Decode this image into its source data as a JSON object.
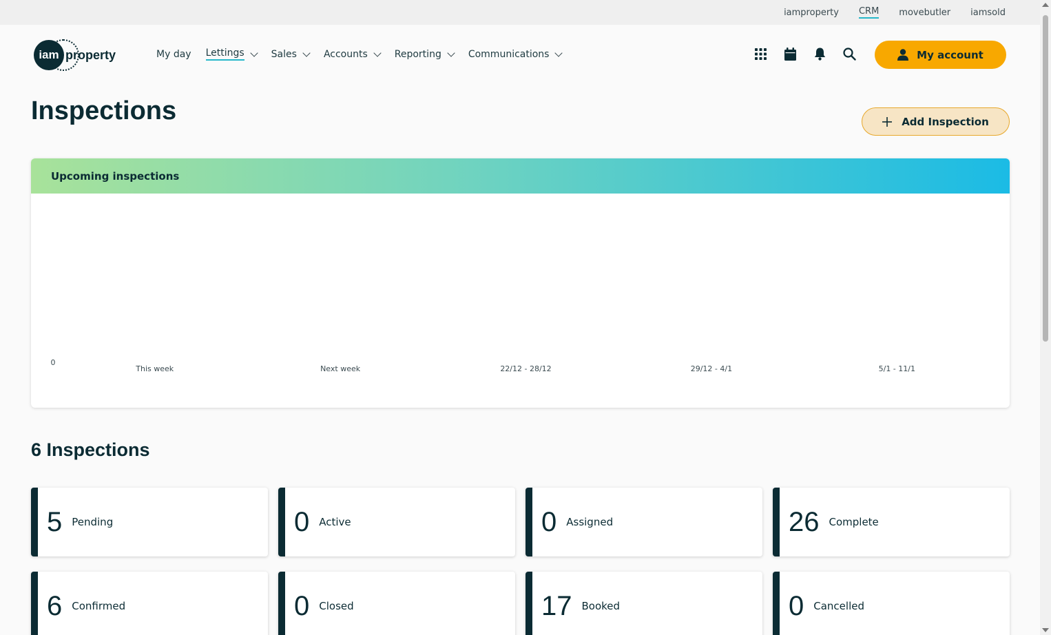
{
  "utility_nav": {
    "links": [
      "iamproperty",
      "CRM",
      "movebutler",
      "iamsold"
    ],
    "active": "CRM"
  },
  "brand": {
    "logo_mark": "iam",
    "logo_text": "property"
  },
  "main_nav": {
    "items": [
      {
        "label": "My day",
        "dropdown": false
      },
      {
        "label": "Lettings",
        "dropdown": true,
        "active": true
      },
      {
        "label": "Sales",
        "dropdown": true
      },
      {
        "label": "Accounts",
        "dropdown": true
      },
      {
        "label": "Reporting",
        "dropdown": true
      },
      {
        "label": "Communications",
        "dropdown": true
      }
    ],
    "icons": [
      "apps-grid-icon",
      "calendar-icon",
      "bell-icon",
      "search-icon"
    ],
    "account_label": "My account"
  },
  "page": {
    "title": "Inspections",
    "add_label": "Add Inspection",
    "accent_color": "#f8a800"
  },
  "chart": {
    "header": "Upcoming inspections"
  },
  "chart_data": {
    "type": "bar",
    "title": "Upcoming inspections",
    "categories": [
      "This week",
      "Next week",
      "22/12 - 28/12",
      "29/12 - 4/1",
      "5/1 - 11/1"
    ],
    "values": [
      0,
      0,
      0,
      0,
      0
    ],
    "y_ticks": [
      "0"
    ],
    "ylim": [
      0,
      1
    ],
    "grid": false
  },
  "summary": {
    "title": "6 Inspections",
    "stats": [
      {
        "value": "5",
        "label": "Pending"
      },
      {
        "value": "0",
        "label": "Active"
      },
      {
        "value": "0",
        "label": "Assigned"
      },
      {
        "value": "26",
        "label": "Complete"
      },
      {
        "value": "6",
        "label": "Confirmed"
      },
      {
        "value": "0",
        "label": "Closed"
      },
      {
        "value": "17",
        "label": "Booked"
      },
      {
        "value": "0",
        "label": "Cancelled"
      }
    ]
  }
}
